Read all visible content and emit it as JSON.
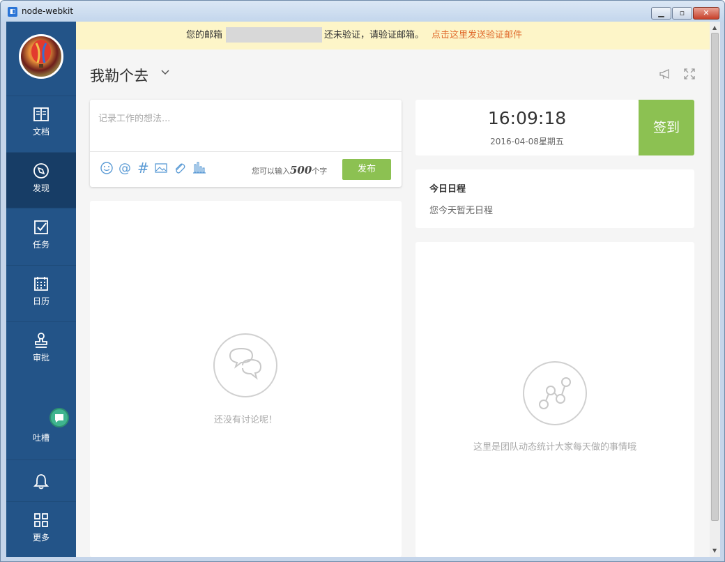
{
  "window": {
    "title": "node-webkit",
    "app_icon": "node-webkit-icon",
    "minimize": "▁",
    "maximize": "▫",
    "close": "✕"
  },
  "banner": {
    "text_before": "您的邮箱",
    "text_after": "还未验证，请验证邮箱。",
    "link": "点击这里发送验证邮件"
  },
  "sidebar": {
    "items": [
      {
        "label": "文档",
        "icon": "document-icon"
      },
      {
        "label": "发现",
        "icon": "compass-icon",
        "active": true
      },
      {
        "label": "任务",
        "icon": "checkbox-icon"
      },
      {
        "label": "日历",
        "icon": "calendar-icon"
      },
      {
        "label": "审批",
        "icon": "stamp-icon"
      },
      {
        "label": "吐槽",
        "icon": "chat-bubble-icon"
      },
      {
        "label": "",
        "icon": "bell-icon"
      },
      {
        "label": "更多",
        "icon": "grid-icon"
      }
    ]
  },
  "header": {
    "team_name": "我勒个去"
  },
  "compose": {
    "placeholder": "记录工作的想法...",
    "limit_prefix": "您可以输入",
    "limit_number": "500",
    "limit_suffix": "个字",
    "publish_label": "发布"
  },
  "discussion": {
    "empty_text": "还没有讨论呢！"
  },
  "clock": {
    "time": "16:09:18",
    "date": "2016-04-08星期五",
    "checkin_label": "签到"
  },
  "schedule": {
    "title": "今日日程",
    "empty_text": "您今天暂无日程"
  },
  "stats": {
    "empty_text": "这里是团队动态统计大家每天做的事情哦"
  },
  "colors": {
    "sidebar": "#235488",
    "sidebar_active": "#173d66",
    "accent_green": "#8cc152",
    "banner_bg": "#fdf5c8",
    "link_orange": "#e06a2c"
  }
}
